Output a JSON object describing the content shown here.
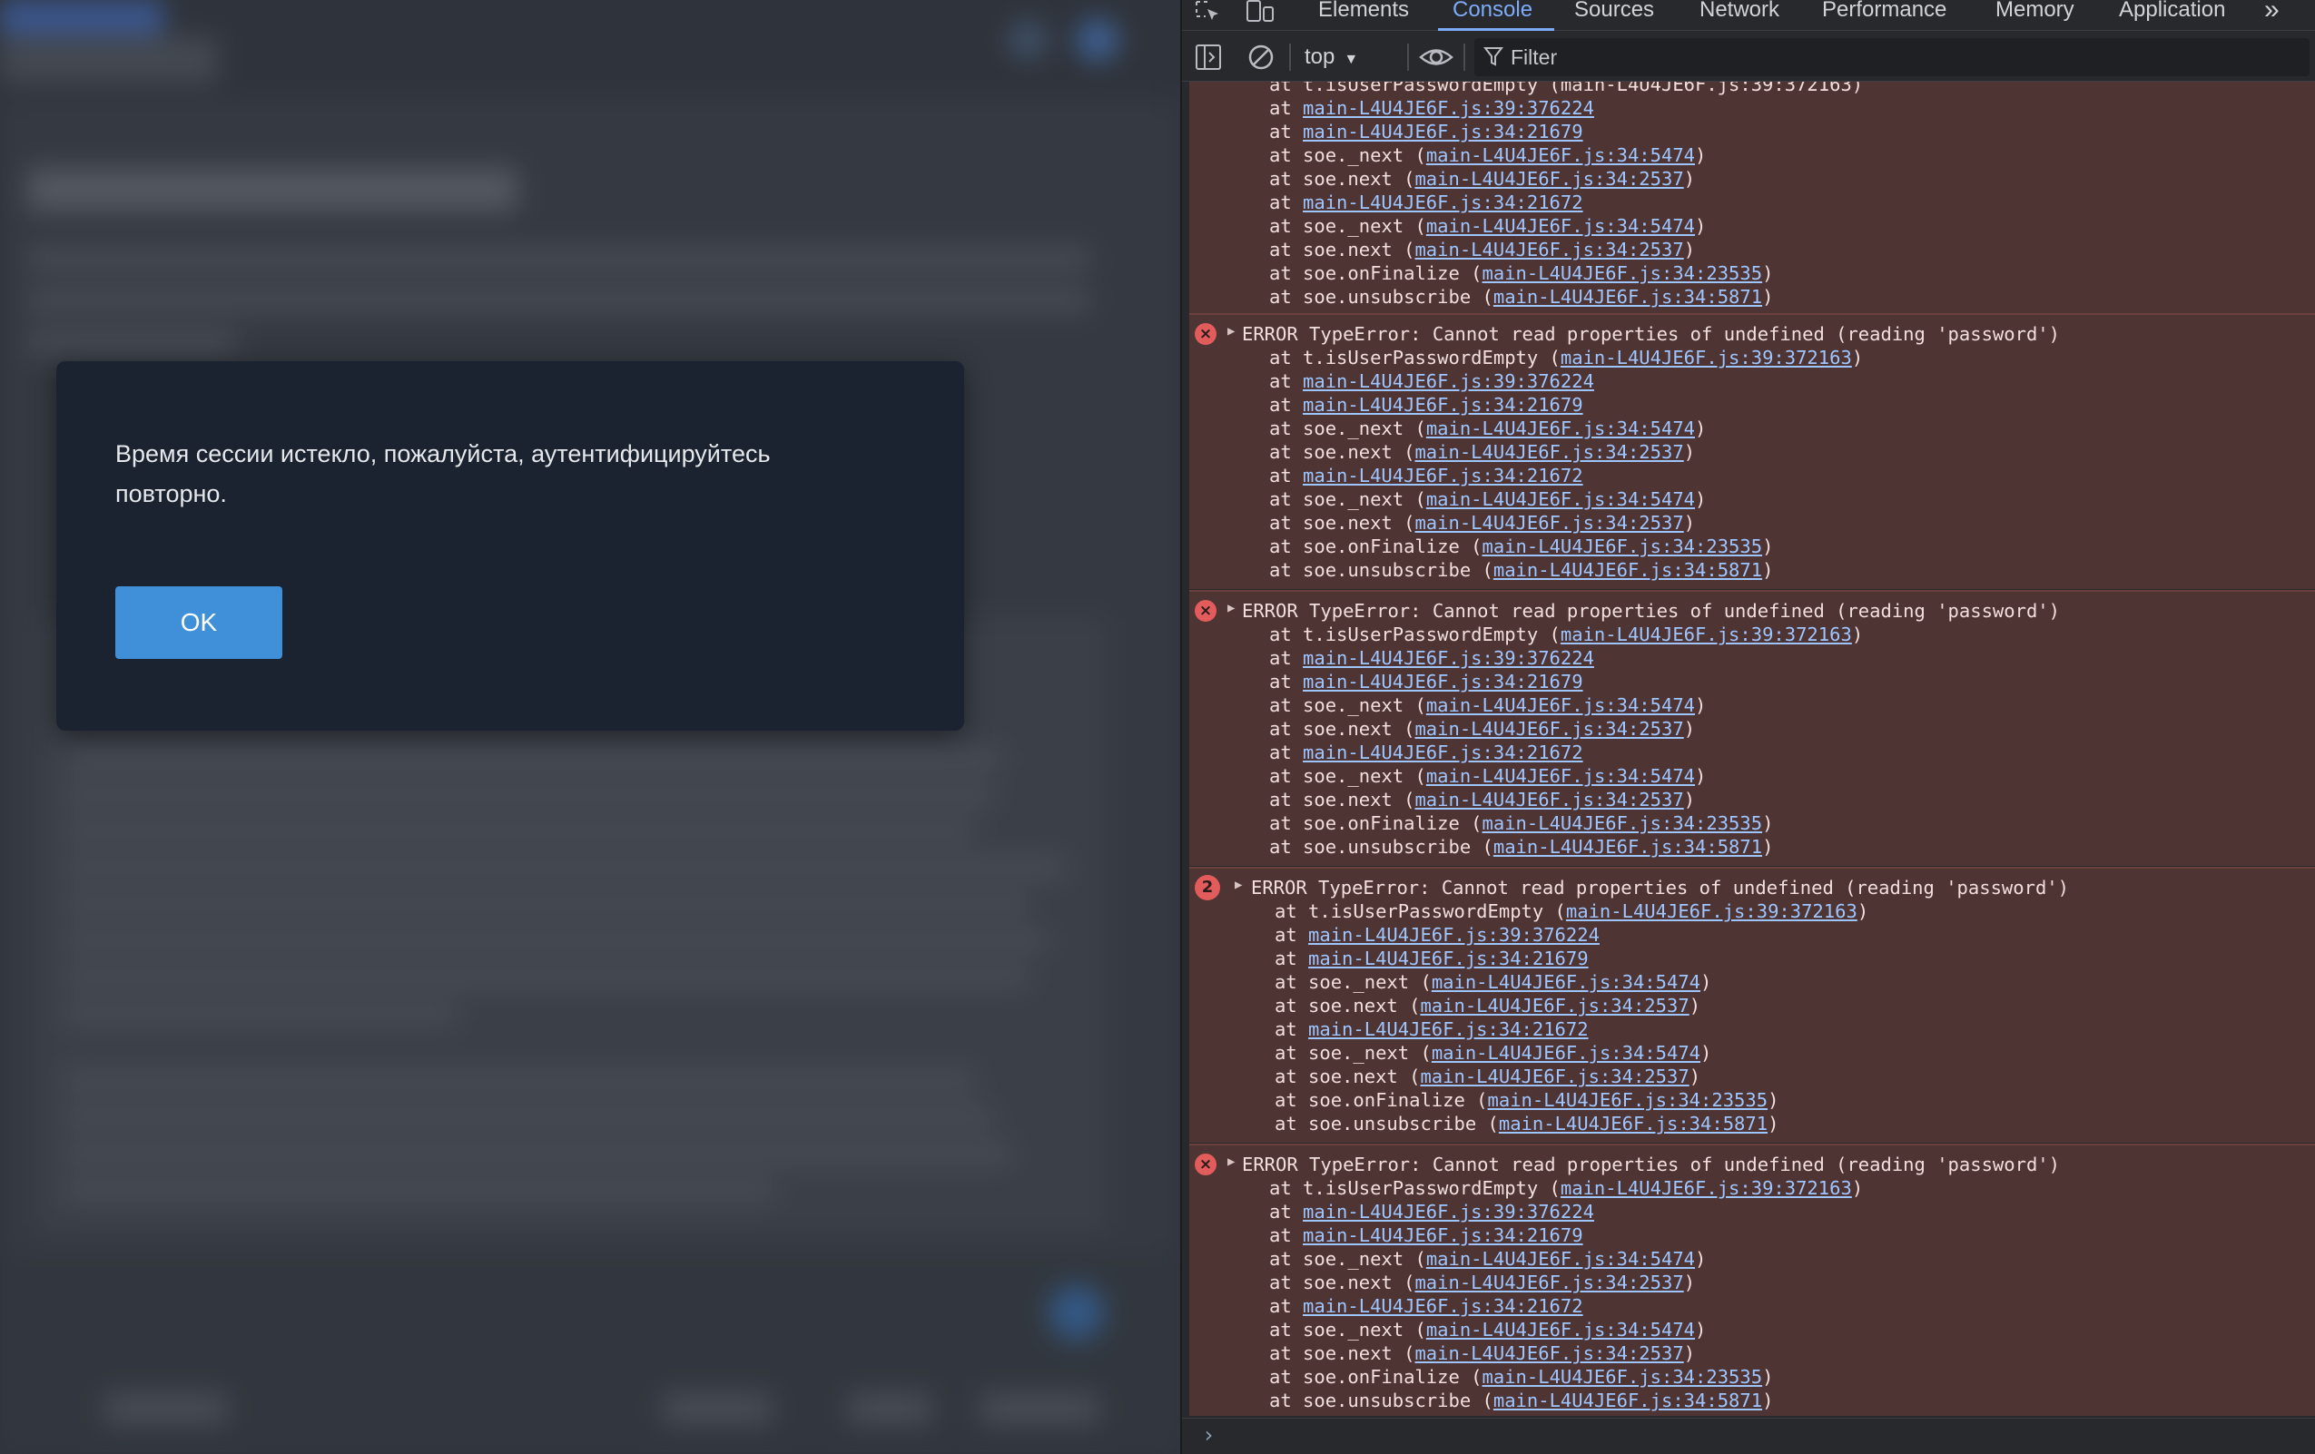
{
  "dialog": {
    "message": "Время сессии истекло, пожалуйста, аутентифицируйтесь повторно.",
    "ok_label": "OK"
  },
  "devtools": {
    "tabs": [
      "Elements",
      "Console",
      "Sources",
      "Network",
      "Performance",
      "Memory",
      "Application"
    ],
    "active_tab": "Console",
    "more_tabs": "»",
    "context": "top",
    "filter_placeholder": "Filter"
  },
  "console": {
    "partial_top": {
      "clipped_line": "at t.isUserPasswordEmpty (main-L4U4JE6F.js:39:372163)",
      "frames": [
        [
          "",
          "main-L4U4JE6F.js:39:376224"
        ],
        [
          "",
          "main-L4U4JE6F.js:34:21679"
        ],
        [
          "soe._next",
          "main-L4U4JE6F.js:34:5474"
        ],
        [
          "soe.next",
          "main-L4U4JE6F.js:34:2537"
        ],
        [
          "",
          "main-L4U4JE6F.js:34:21672"
        ],
        [
          "soe._next",
          "main-L4U4JE6F.js:34:5474"
        ],
        [
          "soe.next",
          "main-L4U4JE6F.js:34:2537"
        ],
        [
          "soe.onFinalize",
          "main-L4U4JE6F.js:34:23535"
        ],
        [
          "soe.unsubscribe",
          "main-L4U4JE6F.js:34:5871"
        ]
      ]
    },
    "errors": [
      {
        "icon": "×",
        "count": "",
        "message": "ERROR TypeError: Cannot read properties of undefined (reading 'password')",
        "frames": [
          [
            "t.isUserPasswordEmpty",
            "main-L4U4JE6F.js:39:372163"
          ],
          [
            "",
            "main-L4U4JE6F.js:39:376224"
          ],
          [
            "",
            "main-L4U4JE6F.js:34:21679"
          ],
          [
            "soe._next",
            "main-L4U4JE6F.js:34:5474"
          ],
          [
            "soe.next",
            "main-L4U4JE6F.js:34:2537"
          ],
          [
            "",
            "main-L4U4JE6F.js:34:21672"
          ],
          [
            "soe._next",
            "main-L4U4JE6F.js:34:5474"
          ],
          [
            "soe.next",
            "main-L4U4JE6F.js:34:2537"
          ],
          [
            "soe.onFinalize",
            "main-L4U4JE6F.js:34:23535"
          ],
          [
            "soe.unsubscribe",
            "main-L4U4JE6F.js:34:5871"
          ]
        ]
      },
      {
        "icon": "×",
        "count": "",
        "message": "ERROR TypeError: Cannot read properties of undefined (reading 'password')",
        "frames": [
          [
            "t.isUserPasswordEmpty",
            "main-L4U4JE6F.js:39:372163"
          ],
          [
            "",
            "main-L4U4JE6F.js:39:376224"
          ],
          [
            "",
            "main-L4U4JE6F.js:34:21679"
          ],
          [
            "soe._next",
            "main-L4U4JE6F.js:34:5474"
          ],
          [
            "soe.next",
            "main-L4U4JE6F.js:34:2537"
          ],
          [
            "",
            "main-L4U4JE6F.js:34:21672"
          ],
          [
            "soe._next",
            "main-L4U4JE6F.js:34:5474"
          ],
          [
            "soe.next",
            "main-L4U4JE6F.js:34:2537"
          ],
          [
            "soe.onFinalize",
            "main-L4U4JE6F.js:34:23535"
          ],
          [
            "soe.unsubscribe",
            "main-L4U4JE6F.js:34:5871"
          ]
        ]
      },
      {
        "icon": "",
        "count": "2",
        "message": "ERROR TypeError: Cannot read properties of undefined (reading 'password')",
        "frames": [
          [
            "t.isUserPasswordEmpty",
            "main-L4U4JE6F.js:39:372163"
          ],
          [
            "",
            "main-L4U4JE6F.js:39:376224"
          ],
          [
            "",
            "main-L4U4JE6F.js:34:21679"
          ],
          [
            "soe._next",
            "main-L4U4JE6F.js:34:5474"
          ],
          [
            "soe.next",
            "main-L4U4JE6F.js:34:2537"
          ],
          [
            "",
            "main-L4U4JE6F.js:34:21672"
          ],
          [
            "soe._next",
            "main-L4U4JE6F.js:34:5474"
          ],
          [
            "soe.next",
            "main-L4U4JE6F.js:34:2537"
          ],
          [
            "soe.onFinalize",
            "main-L4U4JE6F.js:34:23535"
          ],
          [
            "soe.unsubscribe",
            "main-L4U4JE6F.js:34:5871"
          ]
        ]
      },
      {
        "icon": "×",
        "count": "",
        "message": "ERROR TypeError: Cannot read properties of undefined (reading 'password')",
        "frames": [
          [
            "t.isUserPasswordEmpty",
            "main-L4U4JE6F.js:39:372163"
          ],
          [
            "",
            "main-L4U4JE6F.js:39:376224"
          ],
          [
            "",
            "main-L4U4JE6F.js:34:21679"
          ],
          [
            "soe._next",
            "main-L4U4JE6F.js:34:5474"
          ],
          [
            "soe.next",
            "main-L4U4JE6F.js:34:2537"
          ],
          [
            "",
            "main-L4U4JE6F.js:34:21672"
          ],
          [
            "soe._next",
            "main-L4U4JE6F.js:34:5474"
          ],
          [
            "soe.next",
            "main-L4U4JE6F.js:34:2537"
          ],
          [
            "soe.onFinalize",
            "main-L4U4JE6F.js:34:23535"
          ],
          [
            "soe.unsubscribe",
            "main-L4U4JE6F.js:34:5871"
          ]
        ]
      }
    ],
    "prompt": "›"
  },
  "colors": {
    "accent": "#3f8fd9",
    "console_active": "#7cacf8",
    "error_bg": "#4e3534",
    "error_icon": "#e25c5c",
    "link": "#9fc5ff"
  },
  "icons": {
    "inspect": "inspect-element-icon",
    "device": "device-toolbar-icon",
    "sidebar": "console-sidebar-icon",
    "clear": "clear-console-icon",
    "eye": "live-expression-icon",
    "filter": "filter-icon"
  }
}
